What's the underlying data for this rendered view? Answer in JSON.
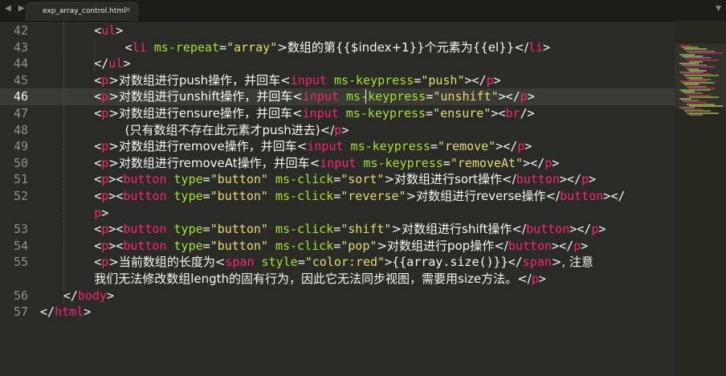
{
  "tab": {
    "title": "exp_array_control.html",
    "close_glyph": "×",
    "nav_glyph": "◀ ▶",
    "overflow_glyph": "▼"
  },
  "colors": {
    "tag": "#f92672",
    "attr": "#a6e22e",
    "string": "#e6db74",
    "text": "#f8f8f2",
    "background": "#2a2b26"
  },
  "current_line": "46",
  "lines": [
    {
      "num": "42",
      "indent": 7,
      "tokens": [
        [
          "p",
          "<"
        ],
        [
          "t",
          "ul"
        ],
        [
          "p",
          ">"
        ]
      ]
    },
    {
      "num": "43",
      "indent": 11,
      "tokens": [
        [
          "p",
          "<"
        ],
        [
          "t",
          "li"
        ],
        [
          "p",
          " "
        ],
        [
          "a",
          "ms-repeat"
        ],
        [
          "p",
          "="
        ],
        [
          "s",
          "\"array\""
        ],
        [
          "p",
          ">数组的第{{$index+1}}个元素为{{el}}</"
        ],
        [
          "t",
          "li"
        ],
        [
          "p",
          ">"
        ]
      ]
    },
    {
      "num": "44",
      "indent": 7,
      "tokens": [
        [
          "p",
          "</"
        ],
        [
          "t",
          "ul"
        ],
        [
          "p",
          ">"
        ]
      ]
    },
    {
      "num": "45",
      "indent": 7,
      "tokens": [
        [
          "p",
          "<"
        ],
        [
          "t",
          "p"
        ],
        [
          "p",
          ">对数组进行push操作，并回车<"
        ],
        [
          "t",
          "input"
        ],
        [
          "p",
          " "
        ],
        [
          "a",
          "ms-keypress"
        ],
        [
          "p",
          "="
        ],
        [
          "s",
          "\"push\""
        ],
        [
          "p",
          "></"
        ],
        [
          "t",
          "p"
        ],
        [
          "p",
          ">"
        ]
      ]
    },
    {
      "num": "46",
      "indent": 7,
      "tokens": [
        [
          "p",
          "<"
        ],
        [
          "t",
          "p"
        ],
        [
          "p",
          ">对数组进行unshift操作，并回车<"
        ],
        [
          "t",
          "input"
        ],
        [
          "p",
          " "
        ],
        [
          "a",
          "ms-keypress"
        ],
        [
          "p",
          "="
        ],
        [
          "s",
          "\"unshift\""
        ],
        [
          "p",
          "></"
        ],
        [
          "t",
          "p"
        ],
        [
          "p",
          ">"
        ]
      ]
    },
    {
      "num": "47",
      "indent": 7,
      "tokens": [
        [
          "p",
          "<"
        ],
        [
          "t",
          "p"
        ],
        [
          "p",
          ">对数组进行ensure操作，并回车<"
        ],
        [
          "t",
          "input"
        ],
        [
          "p",
          " "
        ],
        [
          "a",
          "ms-keypress"
        ],
        [
          "p",
          "="
        ],
        [
          "s",
          "\"ensure\""
        ],
        [
          "p",
          "><"
        ],
        [
          "t",
          "br"
        ],
        [
          "p",
          "/>"
        ]
      ]
    },
    {
      "num": "48",
      "indent": 11,
      "tokens": [
        [
          "p",
          "(只有数组不存在此元素才push进去)</"
        ],
        [
          "t",
          "p"
        ],
        [
          "p",
          ">"
        ]
      ]
    },
    {
      "num": "49",
      "indent": 7,
      "tokens": [
        [
          "p",
          "<"
        ],
        [
          "t",
          "p"
        ],
        [
          "p",
          ">对数组进行remove操作，并回车<"
        ],
        [
          "t",
          "input"
        ],
        [
          "p",
          " "
        ],
        [
          "a",
          "ms-keypress"
        ],
        [
          "p",
          "="
        ],
        [
          "s",
          "\"remove\""
        ],
        [
          "p",
          "></"
        ],
        [
          "t",
          "p"
        ],
        [
          "p",
          ">"
        ]
      ]
    },
    {
      "num": "50",
      "indent": 7,
      "tokens": [
        [
          "p",
          "<"
        ],
        [
          "t",
          "p"
        ],
        [
          "p",
          ">对数组进行removeAt操作，并回车<"
        ],
        [
          "t",
          "input"
        ],
        [
          "p",
          " "
        ],
        [
          "a",
          "ms-keypress"
        ],
        [
          "p",
          "="
        ],
        [
          "s",
          "\"removeAt\""
        ],
        [
          "p",
          "></"
        ],
        [
          "t",
          "p"
        ],
        [
          "p",
          ">"
        ]
      ]
    },
    {
      "num": "51",
      "indent": 7,
      "tokens": [
        [
          "p",
          "<"
        ],
        [
          "t",
          "p"
        ],
        [
          "p",
          "><"
        ],
        [
          "t",
          "button"
        ],
        [
          "p",
          " "
        ],
        [
          "a",
          "type"
        ],
        [
          "p",
          "="
        ],
        [
          "s",
          "\"button\""
        ],
        [
          "p",
          " "
        ],
        [
          "a",
          "ms-click"
        ],
        [
          "p",
          "="
        ],
        [
          "s",
          "\"sort\""
        ],
        [
          "p",
          ">对数组进行sort操作</"
        ],
        [
          "t",
          "button"
        ],
        [
          "p",
          "></"
        ],
        [
          "t",
          "p"
        ],
        [
          "p",
          ">"
        ]
      ]
    },
    {
      "num": "52",
      "indent": 7,
      "tokens": [
        [
          "p",
          "<"
        ],
        [
          "t",
          "p"
        ],
        [
          "p",
          "><"
        ],
        [
          "t",
          "button"
        ],
        [
          "p",
          " "
        ],
        [
          "a",
          "type"
        ],
        [
          "p",
          "="
        ],
        [
          "s",
          "\"button\""
        ],
        [
          "p",
          " "
        ],
        [
          "a",
          "ms-click"
        ],
        [
          "p",
          "="
        ],
        [
          "s",
          "\"reverse\""
        ],
        [
          "p",
          ">对数组进行reverse操作</"
        ],
        [
          "t",
          "button"
        ],
        [
          "p",
          "></"
        ]
      ]
    },
    {
      "num": "",
      "indent": 7,
      "tokens": [
        [
          "t",
          "p"
        ],
        [
          "p",
          ">"
        ]
      ]
    },
    {
      "num": "53",
      "indent": 7,
      "tokens": [
        [
          "p",
          "<"
        ],
        [
          "t",
          "p"
        ],
        [
          "p",
          "><"
        ],
        [
          "t",
          "button"
        ],
        [
          "p",
          " "
        ],
        [
          "a",
          "type"
        ],
        [
          "p",
          "="
        ],
        [
          "s",
          "\"button\""
        ],
        [
          "p",
          " "
        ],
        [
          "a",
          "ms-click"
        ],
        [
          "p",
          "="
        ],
        [
          "s",
          "\"shift\""
        ],
        [
          "p",
          ">对数组进行shift操作</"
        ],
        [
          "t",
          "button"
        ],
        [
          "p",
          "></"
        ],
        [
          "t",
          "p"
        ],
        [
          "p",
          ">"
        ]
      ]
    },
    {
      "num": "54",
      "indent": 7,
      "tokens": [
        [
          "p",
          "<"
        ],
        [
          "t",
          "p"
        ],
        [
          "p",
          "><"
        ],
        [
          "t",
          "button"
        ],
        [
          "p",
          " "
        ],
        [
          "a",
          "type"
        ],
        [
          "p",
          "="
        ],
        [
          "s",
          "\"button\""
        ],
        [
          "p",
          " "
        ],
        [
          "a",
          "ms-click"
        ],
        [
          "p",
          "="
        ],
        [
          "s",
          "\"pop\""
        ],
        [
          "p",
          ">对数组进行pop操作</"
        ],
        [
          "t",
          "button"
        ],
        [
          "p",
          "></"
        ],
        [
          "t",
          "p"
        ],
        [
          "p",
          ">"
        ]
      ]
    },
    {
      "num": "55",
      "indent": 7,
      "tokens": [
        [
          "p",
          "<"
        ],
        [
          "t",
          "p"
        ],
        [
          "p",
          ">当前数组的长度为<"
        ],
        [
          "t",
          "span"
        ],
        [
          "p",
          " "
        ],
        [
          "a",
          "style"
        ],
        [
          "p",
          "="
        ],
        [
          "s",
          "\"color:red\""
        ],
        [
          "p",
          ">{{array.size()}}</"
        ],
        [
          "t",
          "span"
        ],
        [
          "p",
          ">, 注意"
        ]
      ]
    },
    {
      "num": "",
      "indent": 7,
      "tokens": [
        [
          "p",
          "我们无法修改数组length的固有行为，因此它无法同步视图，需要用size方法。</"
        ],
        [
          "t",
          "p"
        ],
        [
          "p",
          ">"
        ]
      ]
    },
    {
      "num": "56",
      "indent": 3,
      "tokens": [
        [
          "p",
          "</"
        ],
        [
          "t",
          "body"
        ],
        [
          "p",
          ">"
        ]
      ]
    },
    {
      "num": "57",
      "indent": 0,
      "tokens": [
        [
          "p",
          "</"
        ],
        [
          "t",
          "html"
        ],
        [
          "p",
          ">"
        ]
      ]
    }
  ]
}
